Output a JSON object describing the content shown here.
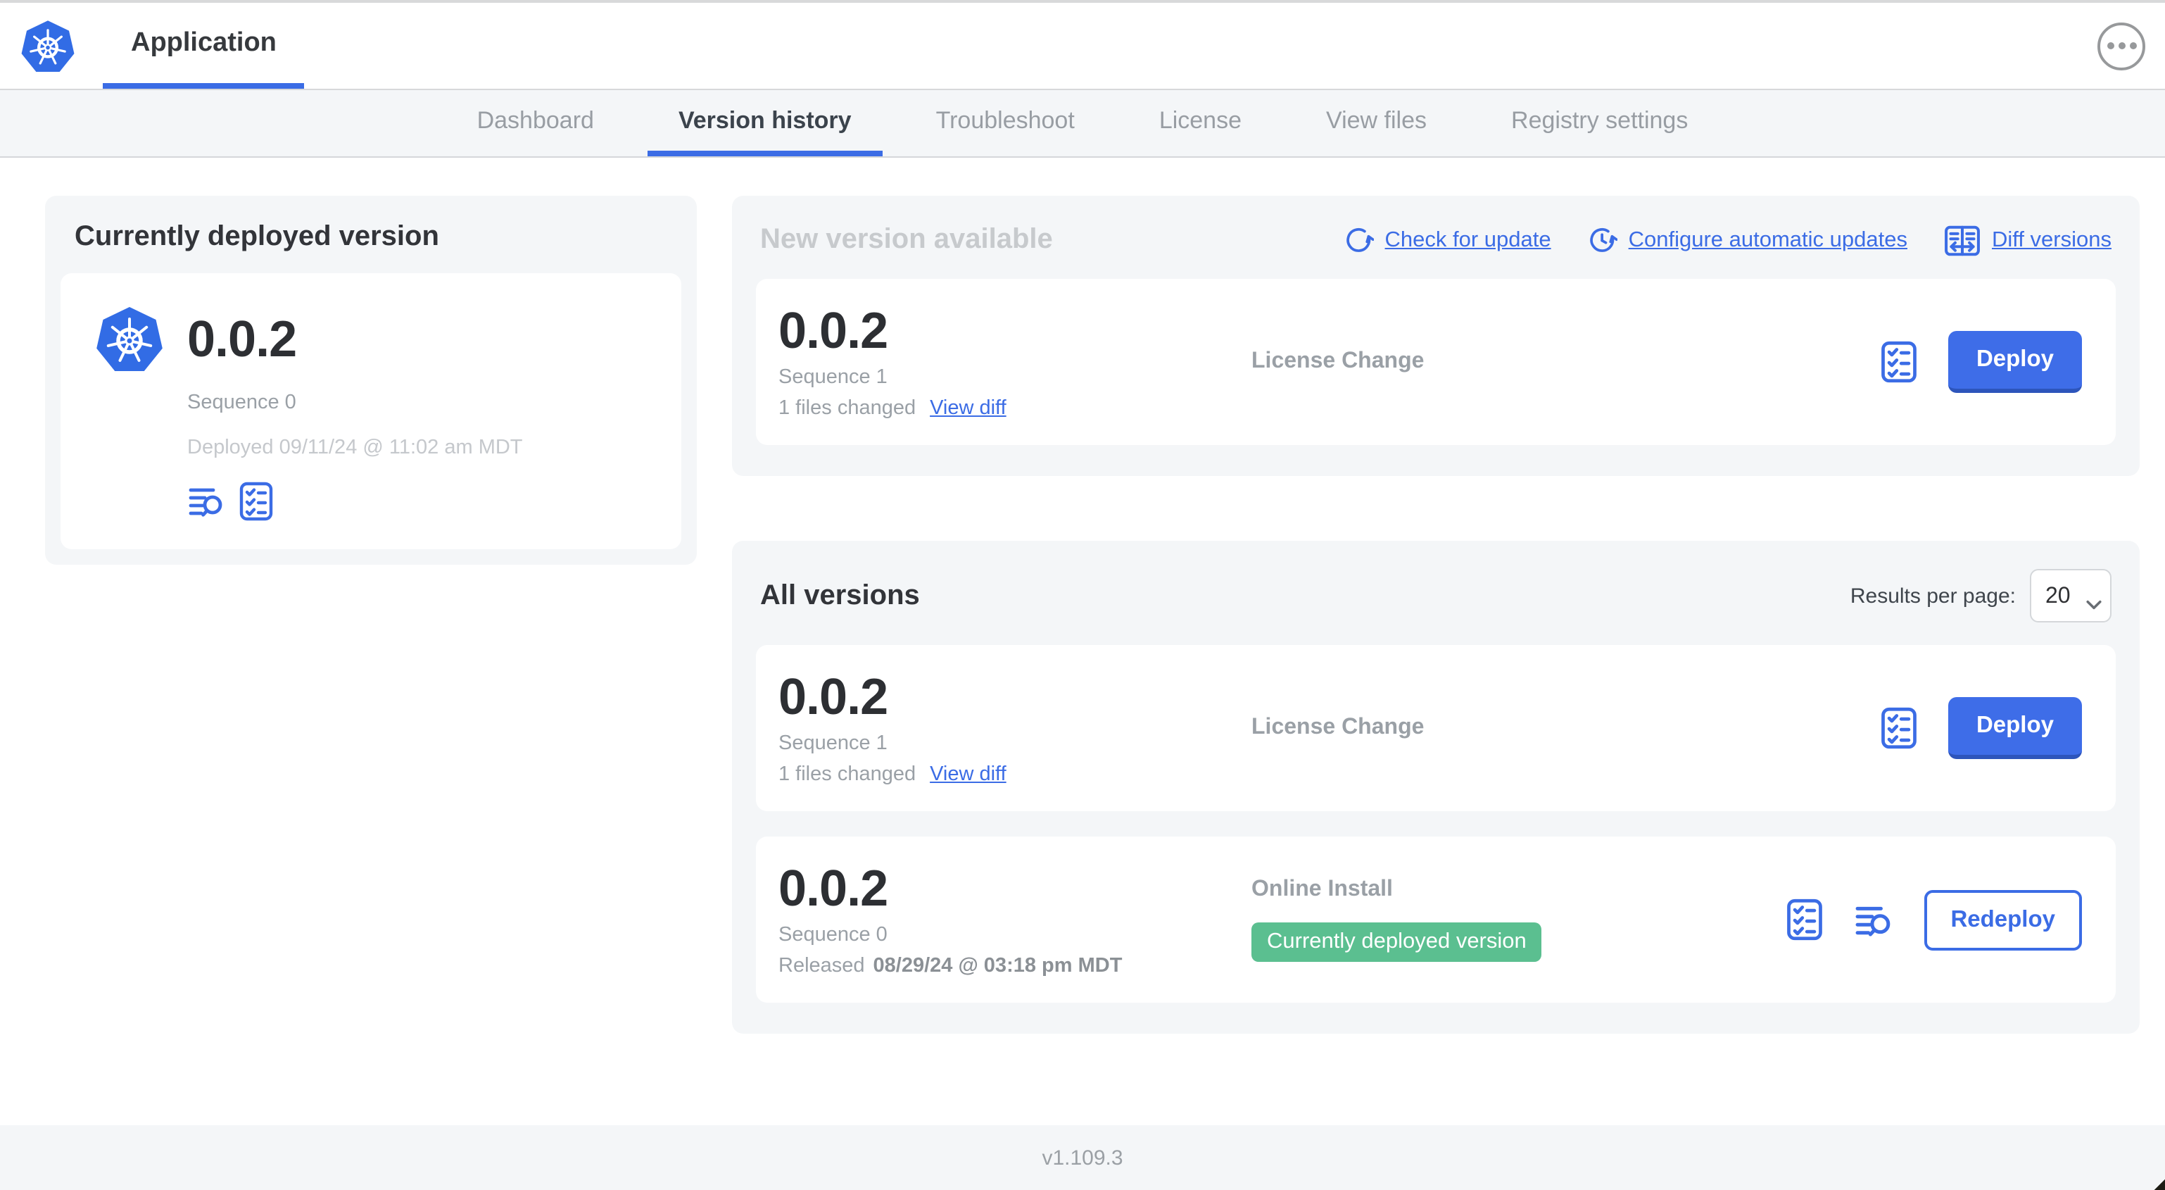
{
  "colors": {
    "accent_blue": "#3b6ce5",
    "kubernetes_blue": "#326ce5",
    "badge_green": "#5bbf90",
    "card_background": "#f4f6f8"
  },
  "icons": {
    "kubernetes": "heptagon-with-ship-wheel",
    "ellipsis": "three-dots-in-circle",
    "refresh": "circular-arrow",
    "auto_update": "clock-with-circular-arrows",
    "diff": "split-panel-with-arrows",
    "logs": "text-lines-with-magnifier",
    "preflight": "checklist-in-rounded-square",
    "chevron_down": "v-chevron"
  },
  "header": {
    "app_title": "Application"
  },
  "nav": {
    "tabs": [
      {
        "label": "Dashboard"
      },
      {
        "label": "Version history"
      },
      {
        "label": "Troubleshoot"
      },
      {
        "label": "License"
      },
      {
        "label": "View files"
      },
      {
        "label": "Registry settings"
      }
    ]
  },
  "current_version": {
    "section_title": "Currently deployed version",
    "number": "0.0.2",
    "sequence": "Sequence 0",
    "deployed": "Deployed 09/11/24 @ 11:02 am MDT"
  },
  "new_version": {
    "section_title": "New version available",
    "actions": [
      {
        "label": "Check for update"
      },
      {
        "label": "Configure automatic updates"
      },
      {
        "label": "Diff versions"
      }
    ],
    "row": {
      "number": "0.0.2",
      "sequence": "Sequence 1",
      "files_changed": "1 files changed",
      "view_diff_label": "View diff",
      "source": "License Change",
      "deploy_label": "Deploy"
    }
  },
  "all_versions": {
    "section_title": "All versions",
    "results_per_page_label": "Results per page:",
    "results_per_page_value": "20",
    "rows": [
      {
        "number": "0.0.2",
        "sequence": "Sequence 1",
        "files_changed": "1 files changed",
        "view_diff_label": "View diff",
        "source": "License Change",
        "action_label": "Deploy"
      },
      {
        "number": "0.0.2",
        "sequence": "Sequence 0",
        "released_label": "Released",
        "released_date": "08/29/24 @ 03:18 pm MDT",
        "source": "Online Install",
        "status_badge": "Currently deployed version",
        "action_label": "Redeploy"
      }
    ]
  },
  "footer": {
    "version": "v1.109.3"
  }
}
